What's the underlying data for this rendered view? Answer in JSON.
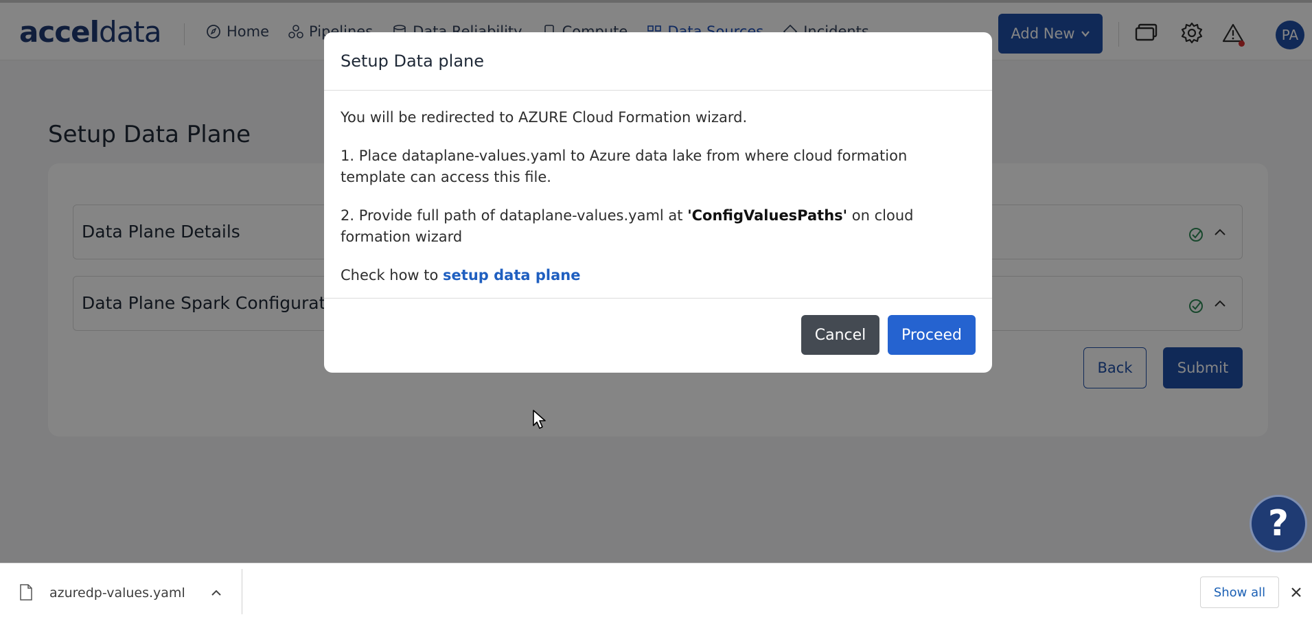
{
  "topbar": {
    "logo_bold": "accel",
    "logo_light": "data",
    "nav": [
      {
        "label": "Home",
        "icon": "compass-icon"
      },
      {
        "label": "Pipelines",
        "icon": "pipelines-icon"
      },
      {
        "label": "Data Reliability",
        "icon": "database-icon"
      },
      {
        "label": "Compute",
        "icon": "compute-icon"
      },
      {
        "label": "Data Sources",
        "icon": "data-sources-icon",
        "active": true
      },
      {
        "label": "Incidents",
        "icon": "incidents-icon"
      }
    ],
    "add_new_label": "Add New",
    "avatar_initials": "PA"
  },
  "page": {
    "title": "Setup Data Plane",
    "sections": [
      {
        "label": "Data Plane Details"
      },
      {
        "label": "Data Plane Spark Configurations"
      }
    ],
    "back_label": "Back",
    "submit_label": "Submit"
  },
  "modal": {
    "title": "Setup Data plane",
    "intro": "You will be redirected to AZURE Cloud Formation wizard.",
    "step1": "1. Place dataplane-values.yaml to Azure data lake from where cloud formation template can access this file.",
    "step2_prefix": "2. Provide full path of dataplane-values.yaml at ",
    "step2_bold": "'ConfigValuesPaths'",
    "step2_suffix": " on cloud formation wizard",
    "check_prefix": "Check how to ",
    "check_link": "setup data plane",
    "cancel_label": "Cancel",
    "proceed_label": "Proceed"
  },
  "help": {
    "label": "?"
  },
  "downloads": {
    "file_name": "azuredp-values.yaml",
    "show_all_label": "Show all"
  },
  "colors": {
    "brand": "#1f4fa8",
    "proceed": "#2563d0",
    "cancel": "#444a52",
    "link": "#1f5fc0"
  }
}
